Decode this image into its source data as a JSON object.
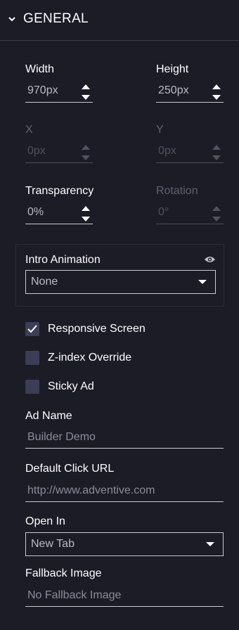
{
  "section": {
    "title": "GENERAL",
    "icon": "chevron-down-icon"
  },
  "dimensions": {
    "width": {
      "label": "Width",
      "value": "970px"
    },
    "height": {
      "label": "Height",
      "value": "250px"
    },
    "x": {
      "label": "X",
      "placeholder": "0px"
    },
    "y": {
      "label": "Y",
      "placeholder": "0px"
    },
    "transparency": {
      "label": "Transparency",
      "value": "0%"
    },
    "rotation": {
      "label": "Rotation",
      "placeholder": "0°"
    }
  },
  "intro_animation": {
    "label": "Intro Animation",
    "value": "None",
    "icon": "eye-icon"
  },
  "checkboxes": [
    {
      "label": "Responsive Screen",
      "checked": true
    },
    {
      "label": "Z-index Override",
      "checked": false
    },
    {
      "label": "Sticky Ad",
      "checked": false
    }
  ],
  "ad_name": {
    "label": "Ad Name",
    "value": "Builder Demo"
  },
  "default_click_url": {
    "label": "Default Click URL",
    "value": "http://www.adventive.com"
  },
  "open_in": {
    "label": "Open In",
    "value": "New Tab"
  },
  "fallback_image": {
    "label": "Fallback Image",
    "value": "No Fallback Image"
  }
}
